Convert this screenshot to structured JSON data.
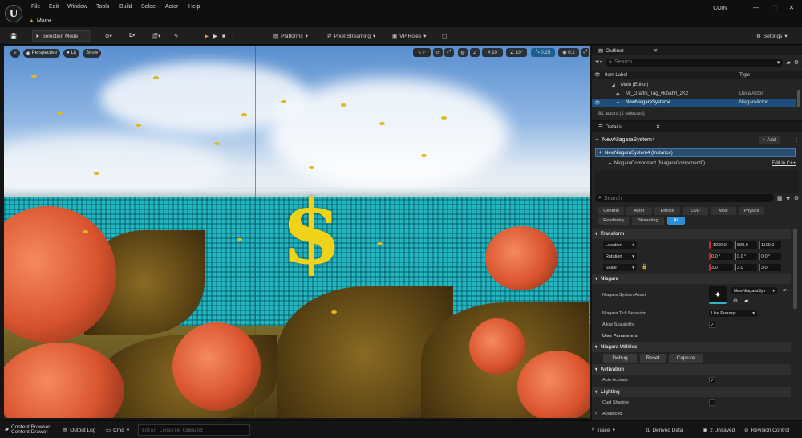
{
  "menu": [
    "File",
    "Edit",
    "Window",
    "Tools",
    "Build",
    "Select",
    "Actor",
    "Help"
  ],
  "tab_title": "Main•",
  "project_name": "COIN",
  "window_controls": {
    "minimize": "—",
    "maximize": "▢",
    "close": "✕"
  },
  "toolbar": {
    "mode": "Selection Mode",
    "platforms": "Platforms",
    "pixel_streaming": "Pixel Streaming",
    "vp_roles": "VP Roles",
    "settings": "Settings"
  },
  "viewport": {
    "perspective": "Perspective",
    "lit": "Lit",
    "show": "Show",
    "grid_snap": "10",
    "rot_snap": "10°",
    "scale_snap": "0.25",
    "camera_speed": "0.1"
  },
  "outliner": {
    "title": "Outliner",
    "search_placeholder": "Search...",
    "col_label": "Item Label",
    "col_type": "Type",
    "items": [
      {
        "label": "Main (Editor)",
        "type": ""
      },
      {
        "label": "MI_Graffiti_Tag_vkziahrl_2K2",
        "type": "DecalActor"
      },
      {
        "label": "NewNiagaraSystem4",
        "type": "NiagaraActor"
      }
    ],
    "status": "81 actors (1 selected)"
  },
  "details": {
    "title": "Details",
    "actor_name": "NewNiagaraSystem4",
    "add_label": "Add",
    "instance": "NewNiagaraSystem4 (Instance)",
    "component": "NiagaraComponent (NiagaraComponent0)",
    "edit_cpp": "Edit in C++",
    "search_placeholder": "Search",
    "filters_row1": [
      "General",
      "Actor",
      "Effects",
      "LOD",
      "Misc",
      "Physics"
    ],
    "filters_row2": [
      "Rendering",
      "Streaming",
      "All"
    ],
    "sections": {
      "transform": "Transform",
      "niagara": "Niagara",
      "user_params": "User Parameters",
      "utilities": "Niagara Utilities",
      "activation": "Activation",
      "lighting": "Lighting",
      "advanced": "Advanced"
    },
    "location": {
      "label": "Location",
      "x": "-1030.0",
      "y": "898.0",
      "z": "1109.0"
    },
    "rotation": {
      "label": "Rotation",
      "x": "0.0 °",
      "y": "0.0 °",
      "z": "0.0 °"
    },
    "scale": {
      "label": "Scale",
      "x": "3.0",
      "y": "3.0",
      "z": "3.0"
    },
    "system_asset_label": "Niagara System Asset",
    "system_asset_value": "NewNiagaraSys",
    "tick_behavior_label": "Niagara Tick Behavior",
    "tick_behavior_value": "Use Prereqs",
    "allow_scalability_label": "Allow Scalability",
    "debug": "Debug",
    "reset": "Reset",
    "capture": "Capture",
    "auto_activate_label": "Auto Activate",
    "cast_shadow_label": "Cast Shadow"
  },
  "statusbar": {
    "content_browser": "Content Browser",
    "content_drawer": "Content Drawer",
    "output_log": "Output Log",
    "cmd": "Cmd",
    "console_placeholder": "Enter Console Command",
    "trace": "Trace",
    "derived_data": "Derived Data",
    "unsaved": "2 Unsaved",
    "revision_control": "Revision Control"
  },
  "colors": {
    "accent": "#2d8fd8",
    "selected_row": "#1d4f7a",
    "x_axis": "#c42d2d",
    "y_axis": "#56a62a",
    "z_axis": "#2d6cc4"
  }
}
